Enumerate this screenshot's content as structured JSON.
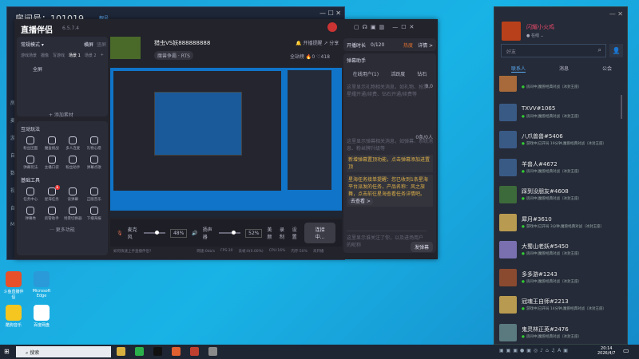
{
  "room_window": {
    "title": "房间号：101019",
    "badge": "靓号",
    "side_items": [
      "房间",
      "麦",
      "游戏",
      "自由",
      "数码",
      "视频",
      "自由",
      "More"
    ]
  },
  "app": {
    "name": "直播伴侣",
    "version": "6.5.7.4",
    "mode": "常规模式 ▾",
    "orient": [
      "横屏",
      "竖屏"
    ],
    "scene_tabs": [
      "游戏场景",
      "摄像",
      "写游戏",
      "场景 1",
      "场景 2",
      "+"
    ],
    "source": "全屏",
    "add_source": "+ 添加素材",
    "interactive_title": "互动玩法",
    "interactive": [
      "粉丝团面",
      "魔盒挑战",
      "多人连麦",
      "礼物心愿",
      "弹幕玩法",
      "主播口袋",
      "粉丝助手",
      "弹幕点歌"
    ],
    "tools_title": "基础工具",
    "tools": [
      "任务中心",
      "星海任务",
      "读弹幕",
      "正版音乐",
      "弹幕秀",
      "房管助手",
      "场景切换器",
      "下播海报"
    ],
    "tools_badge": "1",
    "more": "··· 更多功能",
    "stream_title": "猎虫VS妖888888888",
    "category": "魔兽争霸 · RTS",
    "remind": "开播提醒",
    "share": "分享",
    "rank": "全站榜",
    "likes": "0",
    "hearts": "418",
    "controls": {
      "mic": "麦克风",
      "mic_pct": "48%",
      "mic_level": 48,
      "spk": "扬声器",
      "spk_pct": "52%",
      "spk_level": 52,
      "beauty": "美颜",
      "record": "录制",
      "settings": "设置",
      "connect": "连接中..."
    },
    "status": {
      "help": "如何快速上手直播伴侣?",
      "net": "网速:0kb/s",
      "fps": "FPS:30",
      "drop": "丢帧:0(0.00%)",
      "cpu": "CPU:16%",
      "mem": "内存:50%",
      "live": "未开播"
    },
    "right": {
      "duration_label": "开播时长",
      "duration": "0/120",
      "heat": "热度",
      "detail": "详情 >",
      "assist": "弹幕助手",
      "tabs": [
        "在线用户(1)",
        "活跃度",
        "钻石"
      ],
      "gift_hint": "这里显示礼物相关消息，如礼物、抢票、星耀开通/续费、钻石开通/续费等",
      "gift_val": "0.0",
      "count": "0条/0人",
      "danmu_hint": "这里显示弹幕相关消息，如弹幕、系统消息、粉丝牌升级等",
      "notice1": "新增弹幕置顶功能，点击弹幕添加进置顶",
      "notice2": "星海任务接单提醒：您已收到1条星海平台派发的任务，产品名称：风之旅舞，点击前往星海查看任务详情吧。",
      "notice2_btn": "去查看 >",
      "follow_hint": "这里显示谁关注了你，以及进场用户的昵称",
      "send": "发弹幕"
    }
  },
  "friends": {
    "user": "闪耀小火鸡",
    "status": "在线 ⌄",
    "search_placeholder": "好友",
    "tabs": [
      "联系人",
      "消息",
      "公会"
    ],
    "list": [
      {
        "name": "",
        "status": "房间中|魔兽经典对战（冰封王座）",
        "color": "#a86a3a"
      },
      {
        "name": "TXVV#1065",
        "status": "房间中|魔兽经典对战（冰封王座）",
        "color": "#3a5a86"
      },
      {
        "name": "八爪兽兽#5406",
        "status": "游戏中|已开局 19分钟,魔兽经典对战（冰封王座）",
        "color": "#3a5a86"
      },
      {
        "name": "羊兽人#4672",
        "status": "房间中|魔兽经典对战（冰封王座）",
        "color": "#3a5a86"
      },
      {
        "name": "踩到没朋友#4608",
        "status": "房间中|魔兽经典对战（冰封王座）",
        "color": "#3d6a3a"
      },
      {
        "name": "犀月#3610",
        "status": "游戏中|已开局 3分钟,魔兽经典对战（冰封王座）",
        "color": "#b89a50"
      },
      {
        "name": "大蜀山老妖#5450",
        "status": "房间中|魔兽经典对战（冰封王座）",
        "color": "#7a70b0"
      },
      {
        "name": "多多游#1243",
        "status": "房间中|魔兽经典对战（冰封王座）",
        "color": "#8a4a30"
      },
      {
        "name": "冠魂王自师#2213",
        "status": "游戏中|已开局 14分钟,魔兽经典对战（冰封王座）",
        "color": "#b89a50"
      },
      {
        "name": "鬼灵林正英#2476",
        "status": "房间中|魔兽经典对战（冰封王座）",
        "color": "#5a7a80"
      }
    ]
  },
  "desktop": [
    {
      "label": "斗鱼直播伴侣",
      "color": "#e8502a"
    },
    {
      "label": "Microsoft Edge",
      "color": "#2a9ad8"
    },
    {
      "label": "酷狗音乐",
      "color": "#f5c620"
    },
    {
      "label": "百度网盘",
      "color": "#ffffff"
    }
  ],
  "taskbar": {
    "search": "搜索",
    "time": "20:14",
    "date": "2026/4/7",
    "apps": [
      "#d8b040",
      "#2ab04a",
      "#111111",
      "#e06030",
      "#c04030",
      "#8a8a8a"
    ]
  },
  "colors": {
    "accent": "#e0b24a",
    "link": "#5aa8f0"
  }
}
